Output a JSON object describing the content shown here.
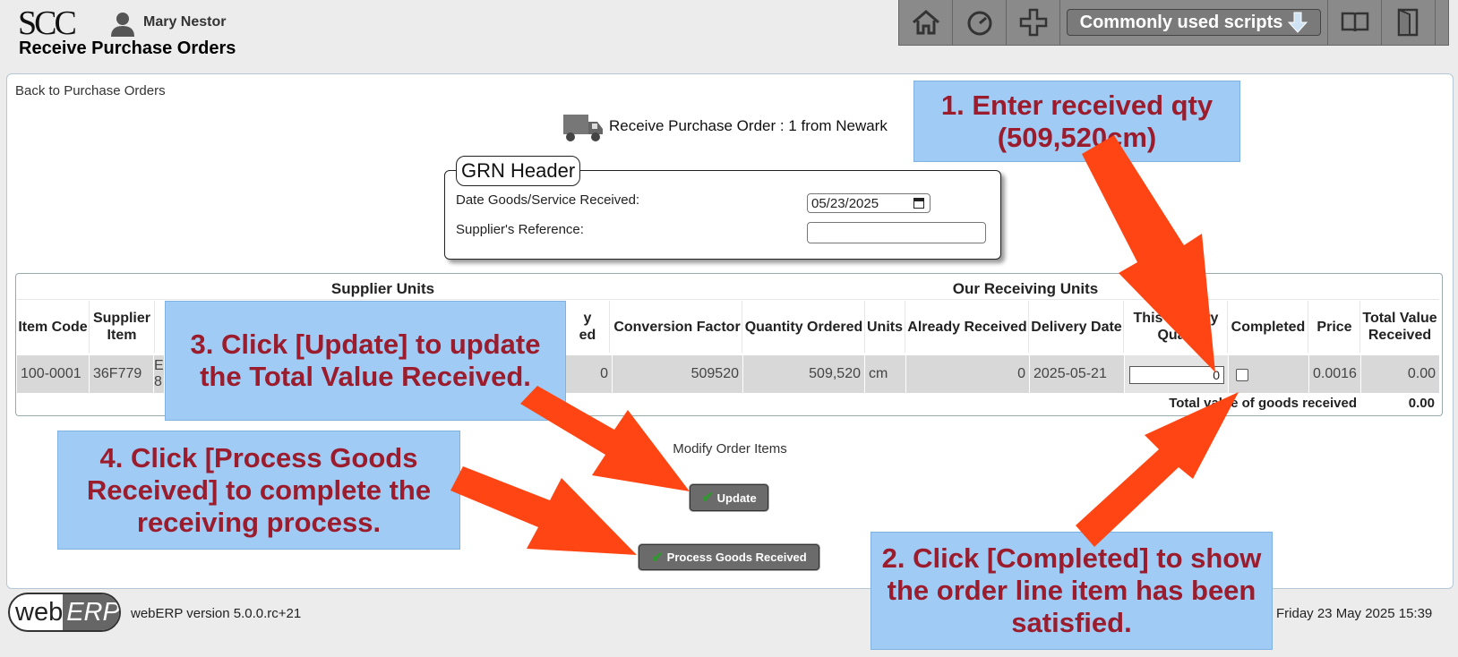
{
  "header": {
    "logo_text": "SCC",
    "user_name": "Mary Nestor",
    "page_title": "Receive Purchase Orders"
  },
  "toolbar": {
    "home_icon": "home-icon",
    "dashboard_icon": "dashboard-icon",
    "add_icon": "plus-icon",
    "scripts_label": "Commonly used scripts",
    "manual_icon": "book-icon",
    "logout_icon": "logout-icon"
  },
  "main": {
    "back_link": "Back to Purchase Orders",
    "po_title": "Receive Purchase Order : 1 from Newark"
  },
  "grn": {
    "legend": "GRN Header",
    "date_label": "Date Goods/Service Received:",
    "date_value": "05/23/2025",
    "ref_label": "Supplier's Reference:",
    "ref_value": ""
  },
  "table": {
    "group_headers": [
      "Supplier Units",
      "Our Receiving Units"
    ],
    "columns": {
      "item_code": "Item Code",
      "supplier_item": "Supplier Item",
      "conversion_factor": "Conversion Factor",
      "quantity_ordered": "Quantity Ordered",
      "units": "Units",
      "already_received": "Already Received",
      "delivery_date": "Delivery Date",
      "this_delivery_partial": "y",
      "completed": "Completed",
      "price": "Price",
      "total_value": "Total Value Received"
    },
    "partial_headers": {
      "supplier_qty_tail": "y",
      "supplier_qty_tail2": "ed",
      "this_delivery_a": "This",
      "this_delivery_b": "ery",
      "qty_partial": "Qua"
    },
    "row": {
      "item_code": "100-0001",
      "supplier_item": "36F779",
      "desc_partial_1": "E",
      "desc_partial_2": "8",
      "supplier_received": "0",
      "conversion_factor": "509520",
      "quantity_ordered": "509,520",
      "units": "cm",
      "already_received": "0",
      "delivery_date": "2025-05-21",
      "this_delivery_qty": "0",
      "price": "0.0016",
      "total_value": "0.00"
    },
    "total_label": "Total value of goods received",
    "total_value": "0.00"
  },
  "actions": {
    "modify_label": "Modify Order Items",
    "update_label": "Update",
    "process_label": "Process Goods Received"
  },
  "footer": {
    "logo_web": "web",
    "logo_erp": "ERP",
    "version": "webERP version 5.0.0.rc+21",
    "datetime": "Friday 23 May 2025 15:39"
  },
  "callouts": {
    "step1": "1. Enter received qty (509,520cm)",
    "step2": "2. Click [Completed] to show the order line item has been satisfied.",
    "step3": "3. Click [Update] to update the Total Value Received.",
    "step4": "4. Click [Process Goods Received] to complete the receiving process."
  },
  "colors": {
    "callout_bg": "#9fcbf5",
    "callout_text": "#9b1c2c",
    "arrow": "#ff4513",
    "toolbar": "#8a8a8a"
  }
}
